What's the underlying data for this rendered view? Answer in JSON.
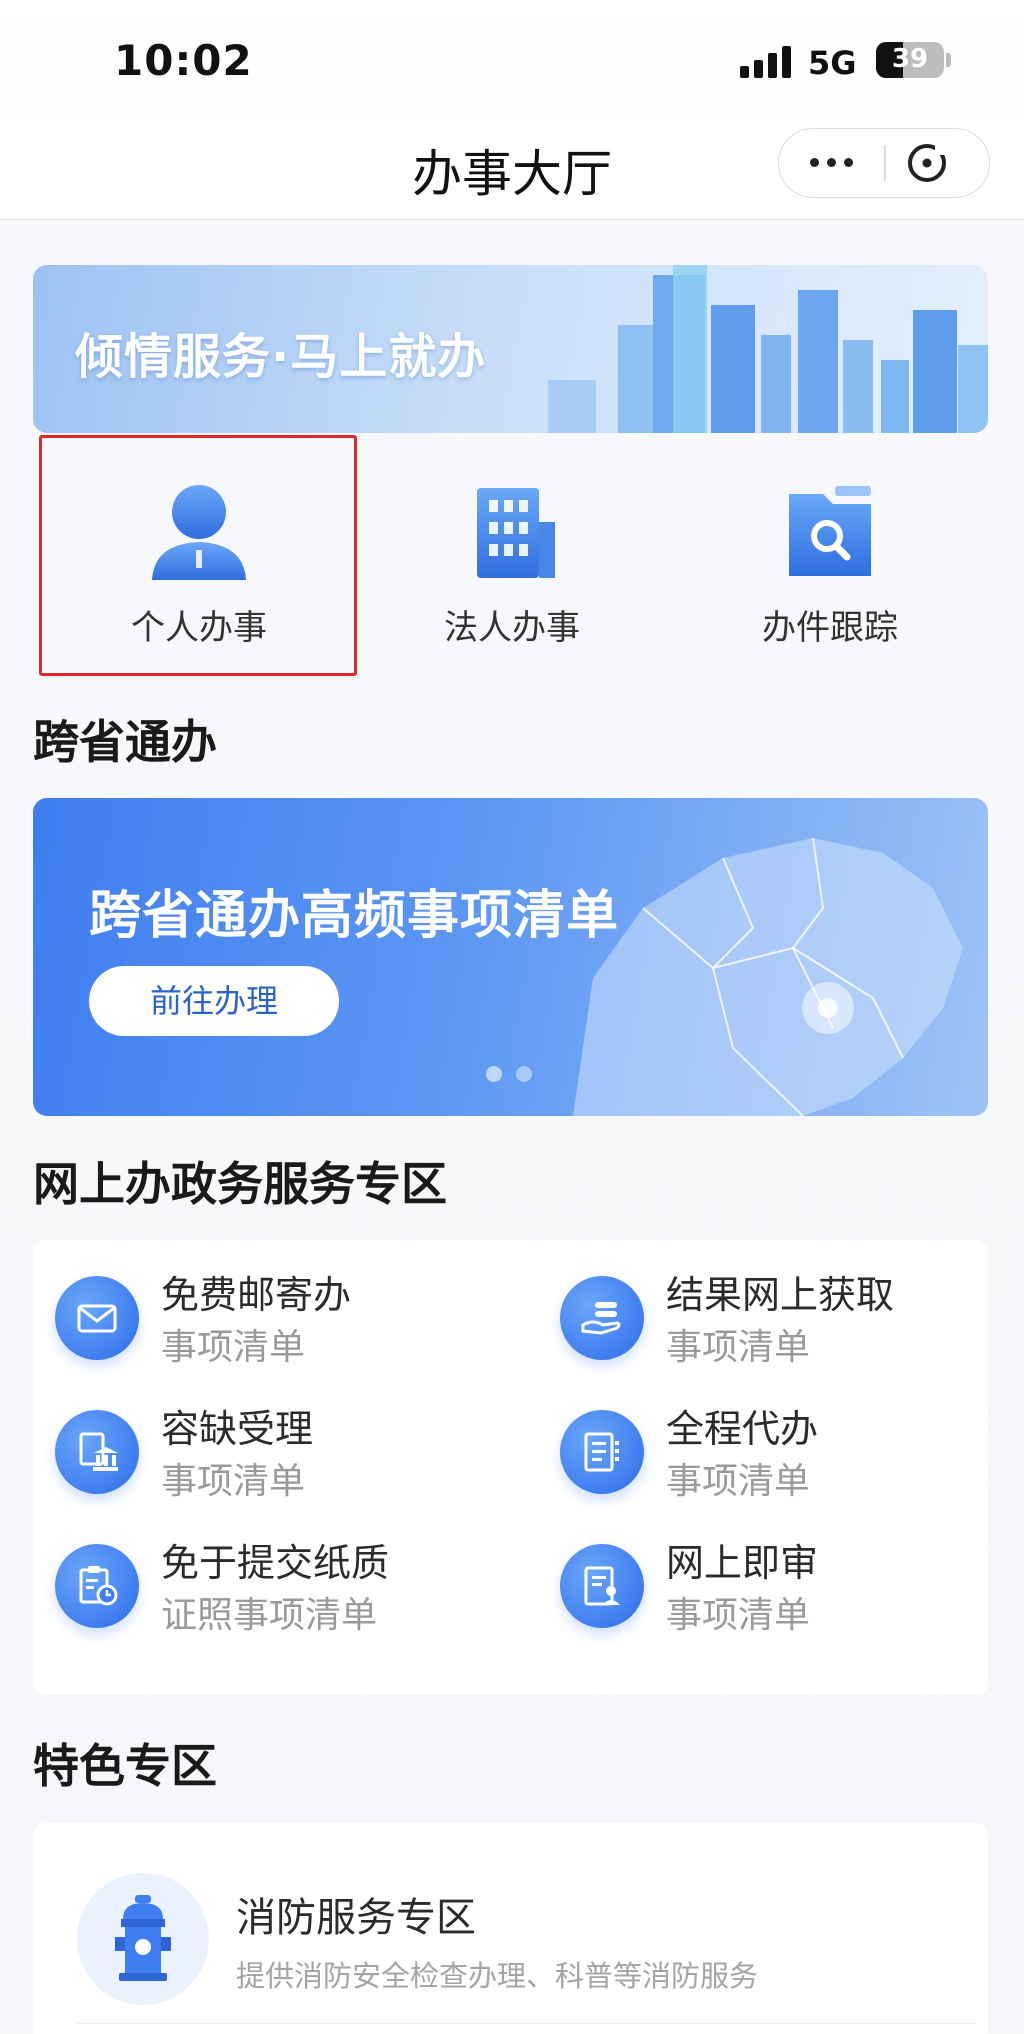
{
  "status_bar": {
    "time": "10:02",
    "network": "5G",
    "battery": "39",
    "battery_level": 0.39
  },
  "nav": {
    "title": "办事大厅"
  },
  "banner": {
    "text": "倾情服务·马上就办"
  },
  "quick_entries": [
    {
      "label": "个人办事",
      "icon": "person-icon"
    },
    {
      "label": "法人办事",
      "icon": "building-icon"
    },
    {
      "label": "办件跟踪",
      "icon": "folder-search-icon"
    }
  ],
  "sections": {
    "cross_province": "跨省通办",
    "online": "网上办政务服务专区",
    "featured": "特色专区"
  },
  "cross_banner": {
    "title": "跨省通办高频事项清单",
    "button": "前往办理"
  },
  "services": [
    {
      "title": "免费邮寄办",
      "sub": "事项清单",
      "icon": "envelope-icon"
    },
    {
      "title": "结果网上获取",
      "sub": "事项清单",
      "icon": "hand-stack-icon"
    },
    {
      "title": "容缺受理",
      "sub": "事项清单",
      "icon": "bank-document-icon"
    },
    {
      "title": "全程代办",
      "sub": "事项清单",
      "icon": "document-list-icon"
    },
    {
      "title": "免于提交纸质",
      "sub": "证照事项清单",
      "icon": "clipboard-clock-icon"
    },
    {
      "title": "网上即审",
      "sub": "事项清单",
      "icon": "document-user-icon"
    }
  ],
  "feature": {
    "title": "消防服务专区",
    "desc": "提供消防安全检查办理、科普等消防服务",
    "icon": "fire-hydrant-icon"
  },
  "colors": {
    "accent": "#3f7ef0",
    "highlight": "#e02727"
  }
}
